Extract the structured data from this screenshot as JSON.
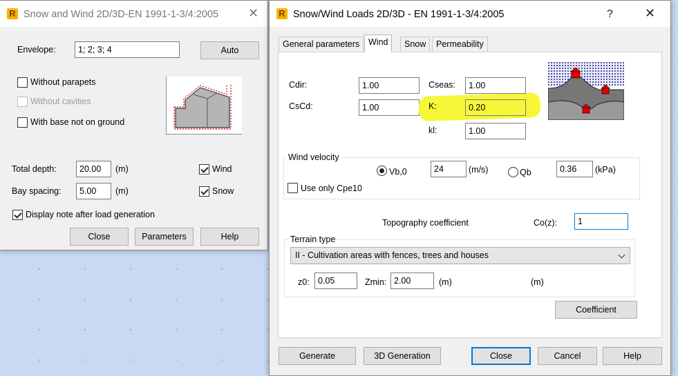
{
  "back_dialog": {
    "title": "Snow and Wind 2D/3D-EN 1991-1-3/4:2005",
    "app_icon": "R",
    "close_glyph": "✕",
    "envelope_label": "Envelope:",
    "envelope_value": "1; 2; 3; 4",
    "auto_button": "Auto",
    "without_parapets": "Without parapets",
    "without_cavities": "Without cavities",
    "with_base": "With base not on ground",
    "total_depth_label": "Total depth:",
    "total_depth_value": "20.00",
    "total_depth_unit": "(m)",
    "bay_spacing_label": "Bay spacing:",
    "bay_spacing_value": "5.00",
    "bay_spacing_unit": "(m)",
    "wind_label": "Wind",
    "snow_label": "Snow",
    "display_note": "Display note after load generation",
    "buttons": {
      "close": "Close",
      "parameters": "Parameters",
      "help": "Help"
    }
  },
  "main_dialog": {
    "title": "Snow/Wind Loads 2D/3D - EN 1991-1-3/4:2005",
    "app_icon": "R",
    "help_glyph": "?",
    "close_glyph": "✕",
    "tabs": [
      "General parameters",
      "Wind",
      "Snow",
      "Permeability"
    ],
    "active_tab": "Wind",
    "coeffs": {
      "cdir_label": "Cdir:",
      "cdir_value": "1.00",
      "cscd_label": "CsCd:",
      "cscd_value": "1.00",
      "cseas_label": "Cseas:",
      "cseas_value": "1.00",
      "k_label": "K:",
      "k_value": "0.20",
      "kl_label": "kl:",
      "kl_value": "1.00"
    },
    "wind_velocity": {
      "group_label": "Wind velocity",
      "vb0_label": "Vb,0",
      "vb0_value": "24",
      "vb0_unit": "(m/s)",
      "qb_label": "Qb",
      "qb_value": "0.36",
      "qb_unit": "(kPa)",
      "selected": "Vb,0",
      "use_only_cpe10": "Use only Cpe10"
    },
    "topography": {
      "label": "Topography coefficient",
      "coz_label": "Co(z):",
      "coz_value": "1"
    },
    "terrain": {
      "group_label": "Terrain type",
      "selected": "II - Cultivation areas with fences, trees and houses",
      "z0_label": "z0:",
      "z0_value": "0.05",
      "zmin_label": "Zmin:",
      "zmin_value": "2.00",
      "zmin_unit": "(m)",
      "extra_unit": "(m)"
    },
    "coefficient_button": "Coefficient",
    "buttons": {
      "generate": "Generate",
      "generation_3d": "3D Generation",
      "close": "Close",
      "cancel": "Cancel",
      "help": "Help"
    }
  },
  "colors": {
    "highlight": "#f7f73a",
    "focus": "#0078d7",
    "canvas": "#c7d9f3",
    "house_roof": "#e00000"
  }
}
